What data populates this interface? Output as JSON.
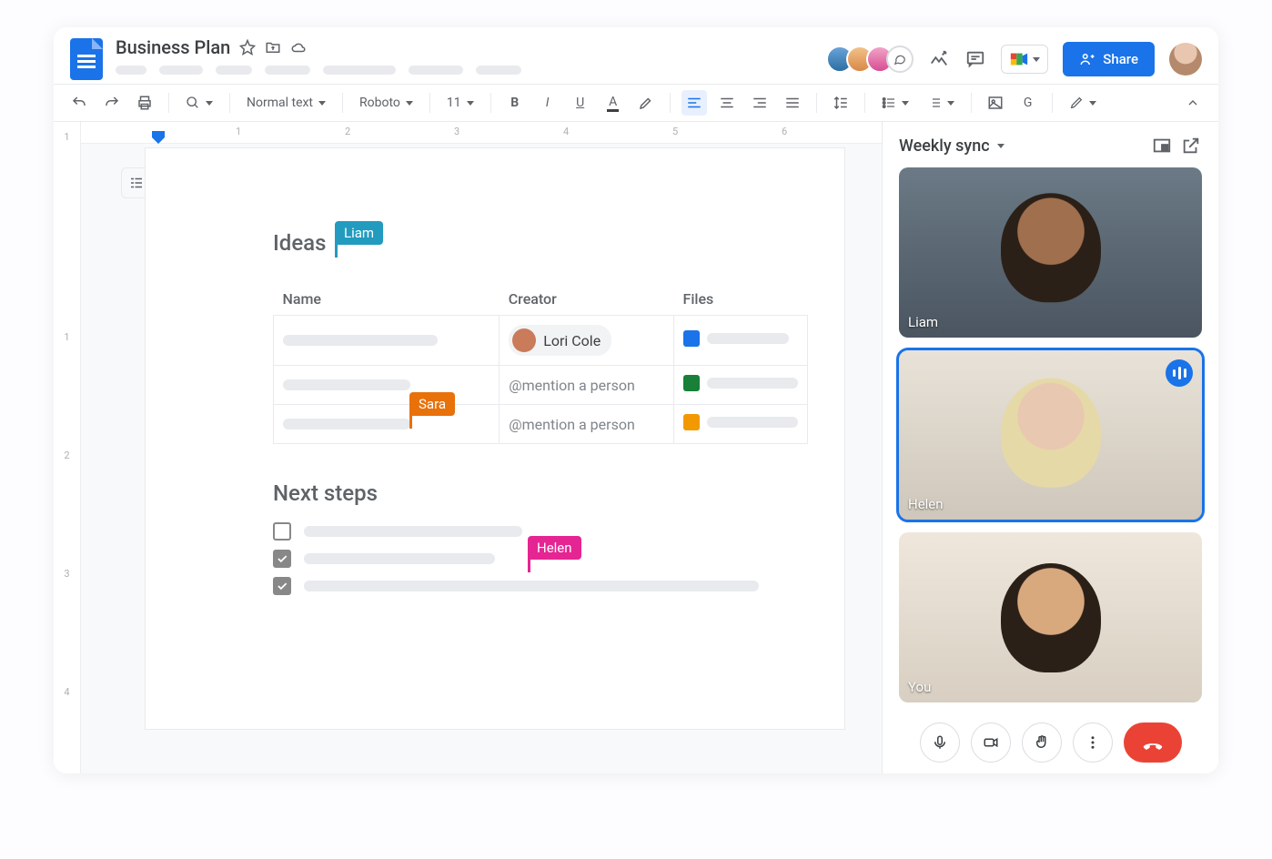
{
  "header": {
    "doc_title": "Business Plan",
    "share_label": "Share"
  },
  "toolbar": {
    "style": "Normal text",
    "font": "Roboto",
    "size": "11"
  },
  "ruler_h": [
    "1",
    "2",
    "3",
    "4",
    "5",
    "6"
  ],
  "ruler_v": [
    "1",
    "1",
    "2",
    "3",
    "4"
  ],
  "doc": {
    "h_ideas": "Ideas",
    "h_next": "Next steps",
    "cols": {
      "name": "Name",
      "creator": "Creator",
      "files": "Files"
    },
    "rows": [
      {
        "creator_label": "Lori Cole",
        "file_type": "doc"
      },
      {
        "creator_placeholder": "@mention a person",
        "file_type": "sheet"
      },
      {
        "creator_placeholder": "@mention a person",
        "file_type": "slide"
      }
    ],
    "cursors": {
      "liam": "Liam",
      "sara": "Sara",
      "helen": "Helen"
    }
  },
  "meet": {
    "title": "Weekly sync",
    "tiles": [
      {
        "name": "Liam",
        "active": false,
        "speaking": false
      },
      {
        "name": "Helen",
        "active": true,
        "speaking": true
      },
      {
        "name": "You",
        "active": false,
        "speaking": false
      }
    ]
  }
}
